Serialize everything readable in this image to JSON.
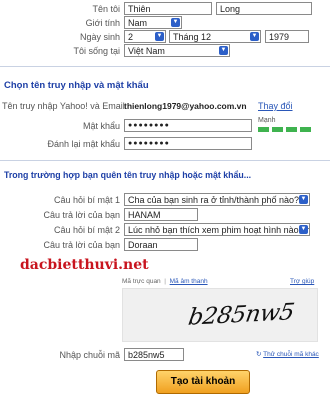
{
  "profile": {
    "name_label": "Tên tôi",
    "first_name": "Thiên",
    "last_name": "Long",
    "gender_label": "Giới tính",
    "gender_value": "Nam",
    "dob_label": "Ngày sinh",
    "dob_day": "2",
    "dob_month": "Tháng 12",
    "dob_year": "1979",
    "country_label": "Tôi sống tại",
    "country_value": "Việt Nam"
  },
  "account": {
    "heading": "Chọn tên truy nhập và mật khẩu",
    "yahoo_id_label": "Tên truy nhập Yahoo! và Email",
    "yahoo_id_value": "thienlong1979@yahoo.com.vn",
    "change_link": "Thay đổi",
    "password_label": "Mật khẩu",
    "password_value": "●●●●●●●●",
    "strength_label": "Mạnh",
    "strength_level": 1.0,
    "confirm_label": "Đánh lại mật khẩu",
    "confirm_value": "●●●●●●●●"
  },
  "recovery": {
    "heading": "Trong trường hợp bạn quên tên truy nhập hoặc mật khẩu...",
    "q1_label": "Câu hỏi bí mật 1",
    "q1_value": "Cha của bạn sinh ra ở tỉnh/thành phố nào?",
    "a1_label": "Câu trả lời của bạn",
    "a1_value": "HANAM",
    "q2_label": "Câu hỏi bí mật 2",
    "q2_value": "Lúc nhỏ bạn thích xem phim hoạt hình nào nh",
    "a2_label": "Câu trả lời của bạn",
    "a2_value": "Doraan"
  },
  "watermark": "dacbietthuvi.net",
  "captcha": {
    "tab_visual": "Mã trực quan",
    "tab_audio": "Mã âm thanh",
    "help": "Trợ giúp",
    "image_text": "b285nw5",
    "input_label": "Nhập chuỗi mã",
    "input_value": "b285nw5",
    "refresh_link": "Thử chuỗi mã khác"
  },
  "submit_label": "Tạo tài khoản",
  "colors": {
    "heading_blue": "#1d3fa6",
    "link_blue": "#2a57b8",
    "strength_green": "#3fb34f",
    "watermark_red": "#c8141e",
    "submit_orange": "#f0a020"
  }
}
